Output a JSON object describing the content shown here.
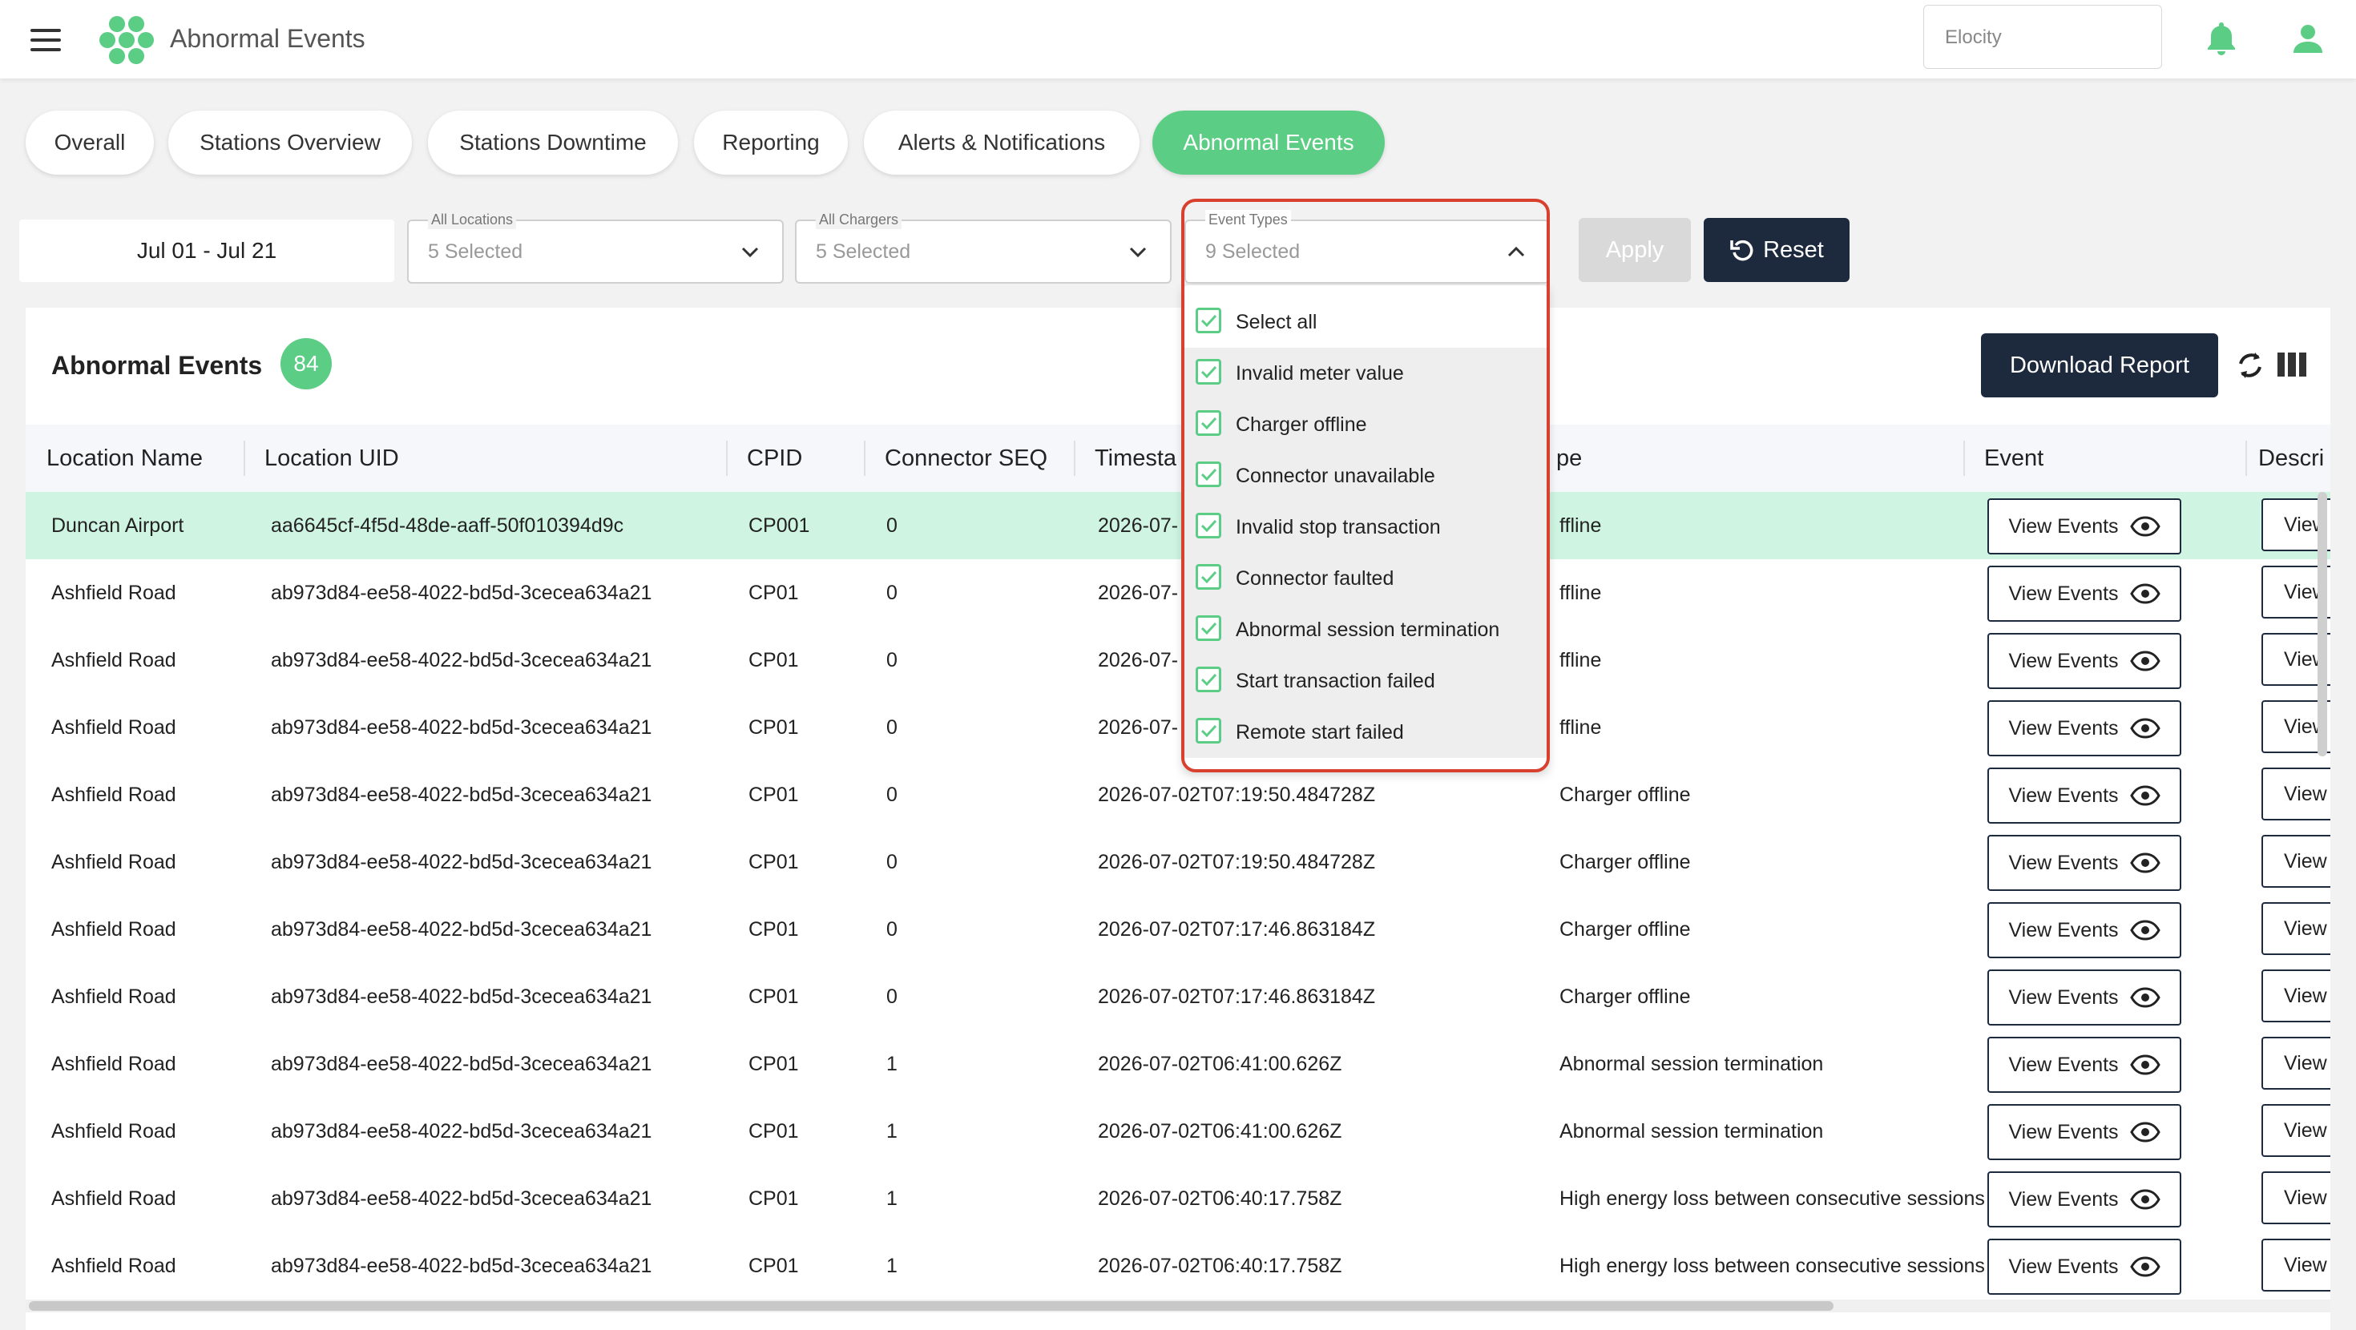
{
  "app": {
    "title": "Abnormal Events",
    "org_placeholder": "Elocity"
  },
  "tabs": [
    "Overall",
    "Stations Overview",
    "Stations Downtime",
    "Reporting",
    "Alerts & Notifications",
    "Abnormal Events"
  ],
  "filters": {
    "date_range": "Jul 01 - Jul 21",
    "locations": {
      "label": "All Locations",
      "value": "5 Selected"
    },
    "chargers": {
      "label": "All Chargers",
      "value": "5 Selected"
    },
    "event_types": {
      "label": "Event Types",
      "value": "9 Selected"
    },
    "apply_label": "Apply",
    "reset_label": "Reset"
  },
  "dropdown": {
    "options": [
      "Select all",
      "Invalid meter value",
      "Charger offline",
      "Connector unavailable",
      "Invalid stop transaction",
      "Connector faulted",
      "Abnormal session termination",
      "Start transaction failed",
      "Remote start failed"
    ]
  },
  "card": {
    "title": "Abnormal Events",
    "count": "84",
    "download_label": "Download Report"
  },
  "table": {
    "headers": [
      "Location Name",
      "Location UID",
      "CPID",
      "Connector SEQ",
      "Timesta",
      "pe",
      "Event",
      "Descri"
    ],
    "view_label": "View Events",
    "desc_label": "View",
    "rows": [
      [
        "Duncan Airport",
        "aa6645cf-4f5d-48de-aaff-50f010394d9c",
        "CP001",
        "0",
        "2026-07-",
        "ffline"
      ],
      [
        "Ashfield Road",
        "ab973d84-ee58-4022-bd5d-3cecea634a21",
        "CP01",
        "0",
        "2026-07-",
        "ffline"
      ],
      [
        "Ashfield Road",
        "ab973d84-ee58-4022-bd5d-3cecea634a21",
        "CP01",
        "0",
        "2026-07-",
        "ffline"
      ],
      [
        "Ashfield Road",
        "ab973d84-ee58-4022-bd5d-3cecea634a21",
        "CP01",
        "0",
        "2026-07-",
        "ffline"
      ],
      [
        "Ashfield Road",
        "ab973d84-ee58-4022-bd5d-3cecea634a21",
        "CP01",
        "0",
        "2026-07-02T07:19:50.484728Z",
        "Charger offline"
      ],
      [
        "Ashfield Road",
        "ab973d84-ee58-4022-bd5d-3cecea634a21",
        "CP01",
        "0",
        "2026-07-02T07:19:50.484728Z",
        "Charger offline"
      ],
      [
        "Ashfield Road",
        "ab973d84-ee58-4022-bd5d-3cecea634a21",
        "CP01",
        "0",
        "2026-07-02T07:17:46.863184Z",
        "Charger offline"
      ],
      [
        "Ashfield Road",
        "ab973d84-ee58-4022-bd5d-3cecea634a21",
        "CP01",
        "0",
        "2026-07-02T07:17:46.863184Z",
        "Charger offline"
      ],
      [
        "Ashfield Road",
        "ab973d84-ee58-4022-bd5d-3cecea634a21",
        "CP01",
        "1",
        "2026-07-02T06:41:00.626Z",
        "Abnormal session termination"
      ],
      [
        "Ashfield Road",
        "ab973d84-ee58-4022-bd5d-3cecea634a21",
        "CP01",
        "1",
        "2026-07-02T06:41:00.626Z",
        "Abnormal session termination"
      ],
      [
        "Ashfield Road",
        "ab973d84-ee58-4022-bd5d-3cecea634a21",
        "CP01",
        "1",
        "2026-07-02T06:40:17.758Z",
        "High energy loss between consecutive sessions"
      ],
      [
        "Ashfield Road",
        "ab973d84-ee58-4022-bd5d-3cecea634a21",
        "CP01",
        "1",
        "2026-07-02T06:40:17.758Z",
        "High energy loss between consecutive sessions"
      ]
    ]
  },
  "colors": {
    "accent": "#5ccd84",
    "navy": "#1d2a3e",
    "highlight_row": "#cff5e2",
    "dropdown_outline": "#d9412f"
  }
}
